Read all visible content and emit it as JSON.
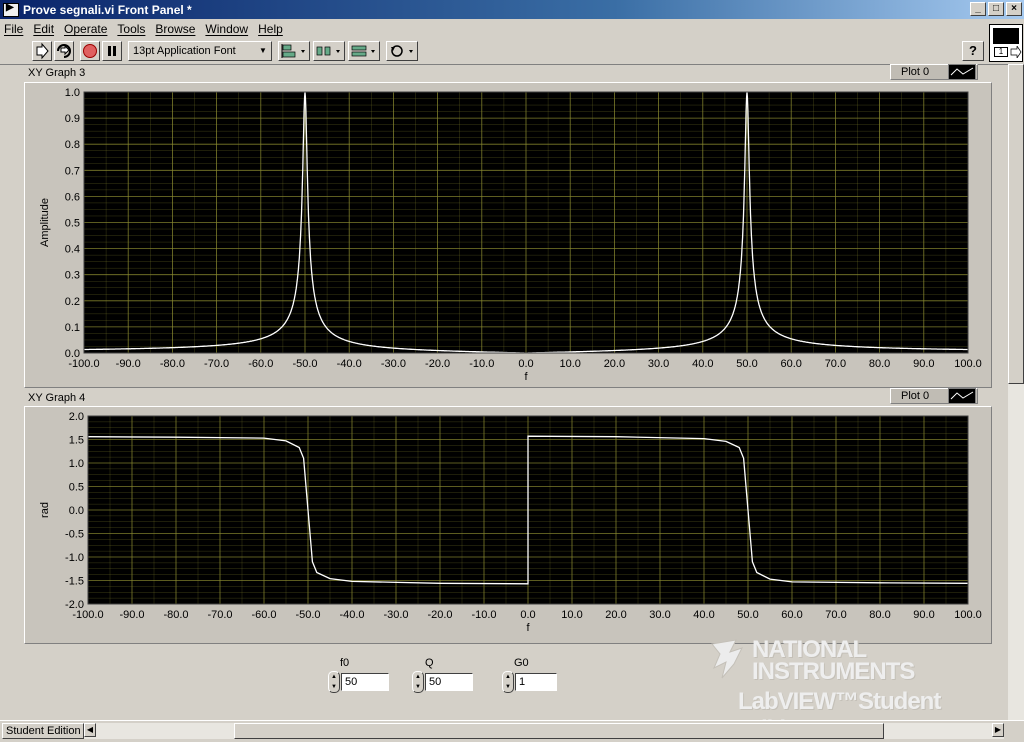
{
  "window": {
    "title": "Prove segnali.vi Front Panel *",
    "buttons": [
      "_",
      "□",
      "×"
    ]
  },
  "menu": [
    "File",
    "Edit",
    "Operate",
    "Tools",
    "Browse",
    "Window",
    "Help"
  ],
  "toolbar": {
    "font": "13pt Application Font",
    "help_icon": "?",
    "vi_icon_number": "1"
  },
  "graphs": [
    {
      "label": "XY Graph 3",
      "legend": "Plot 0",
      "xlabel": "f",
      "ylabel": "Amplitude",
      "xticks": [
        "-100.0",
        "-90.0",
        "-80.0",
        "-70.0",
        "-60.0",
        "-50.0",
        "-40.0",
        "-30.0",
        "-20.0",
        "-10.0",
        "0.0",
        "10.0",
        "20.0",
        "30.0",
        "40.0",
        "50.0",
        "60.0",
        "70.0",
        "80.0",
        "90.0",
        "100.0"
      ],
      "yticks": [
        "0.0",
        "0.1",
        "0.2",
        "0.3",
        "0.4",
        "0.5",
        "0.6",
        "0.7",
        "0.8",
        "0.9",
        "1.0"
      ]
    },
    {
      "label": "XY Graph 4",
      "legend": "Plot 0",
      "xlabel": "f",
      "ylabel": "rad",
      "xticks": [
        "-100.0",
        "-90.0",
        "-80.0",
        "-70.0",
        "-60.0",
        "-50.0",
        "-40.0",
        "-30.0",
        "-20.0",
        "-10.0",
        "0.0",
        "10.0",
        "20.0",
        "30.0",
        "40.0",
        "50.0",
        "60.0",
        "70.0",
        "80.0",
        "90.0",
        "100.0"
      ],
      "yticks": [
        "-2.0",
        "-1.5",
        "-1.0",
        "-0.5",
        "0.0",
        "0.5",
        "1.0",
        "1.5",
        "2.0"
      ]
    }
  ],
  "chart_data": [
    {
      "type": "line",
      "xlabel": "f",
      "ylabel": "Amplitude",
      "xlim": [
        -100,
        100
      ],
      "ylim": [
        0,
        1
      ],
      "grid": true,
      "series": [
        {
          "name": "Plot 0",
          "description": "resonance magnitude peaks at f = -50 and f = 50",
          "f0": 50,
          "Q": 50,
          "G0": 1,
          "x": [
            -100,
            -80,
            -70,
            -60,
            -55,
            -52,
            -51,
            -50,
            -49,
            -48,
            -45,
            -40,
            -30,
            -20,
            -10,
            0,
            10,
            20,
            30,
            40,
            45,
            48,
            49,
            50,
            51,
            52,
            55,
            60,
            70,
            80,
            100
          ],
          "y": [
            0.013,
            0.022,
            0.029,
            0.045,
            0.095,
            0.24,
            0.45,
            1.0,
            0.45,
            0.24,
            0.09,
            0.045,
            0.019,
            0.0085,
            0.003,
            0.0,
            0.003,
            0.0085,
            0.019,
            0.045,
            0.09,
            0.24,
            0.45,
            1.0,
            0.45,
            0.24,
            0.095,
            0.045,
            0.029,
            0.022,
            0.013
          ]
        }
      ]
    },
    {
      "type": "line",
      "xlabel": "f",
      "ylabel": "rad",
      "xlim": [
        -100,
        100
      ],
      "ylim": [
        -2,
        2
      ],
      "grid": true,
      "series": [
        {
          "name": "Plot 0",
          "x": [
            -100,
            -80,
            -60,
            -55,
            -52,
            -51,
            -50,
            -49,
            -48,
            -45,
            -40,
            -20,
            -0.01,
            0.01,
            20,
            40,
            45,
            48,
            49,
            50,
            51,
            52,
            55,
            60,
            80,
            100
          ],
          "y": [
            1.56,
            1.55,
            1.53,
            1.47,
            1.33,
            1.1,
            0.0,
            -1.1,
            -1.33,
            -1.46,
            -1.52,
            -1.56,
            -1.57,
            1.57,
            1.56,
            1.52,
            1.46,
            1.33,
            1.1,
            0.0,
            -1.1,
            -1.33,
            -1.47,
            -1.53,
            -1.55,
            -1.56
          ]
        }
      ]
    }
  ],
  "controls": [
    {
      "label": "f0",
      "value": "50"
    },
    {
      "label": "Q",
      "value": "50"
    },
    {
      "label": "G0",
      "value": "1"
    }
  ],
  "branding": {
    "line1": "NATIONAL",
    "line2": "INSTRUMENTS",
    "line3": "LabVIEW™Student Edition"
  },
  "statusbar": {
    "edition": "Student Edition"
  },
  "colors": {
    "plot_bg": "#000000",
    "grid": "#8a8a30",
    "trace": "#ffffff"
  }
}
